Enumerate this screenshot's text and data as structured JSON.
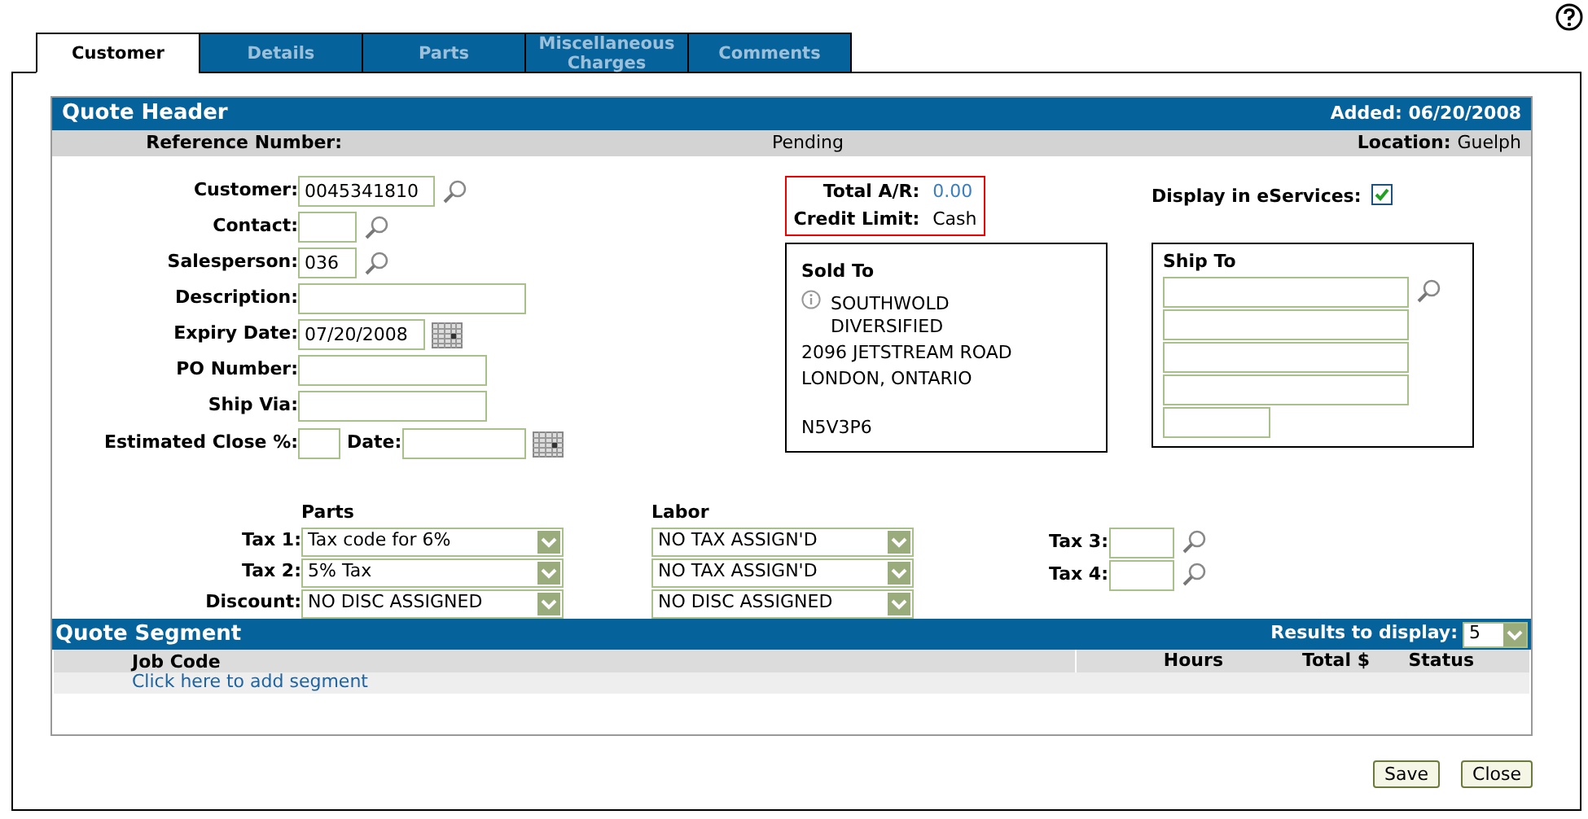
{
  "tabs": [
    {
      "label": "Customer",
      "selected": true
    },
    {
      "label": "Details",
      "selected": false
    },
    {
      "label": "Parts",
      "selected": false
    },
    {
      "label": "Miscellaneous Charges",
      "selected": false
    },
    {
      "label": "Comments",
      "selected": false
    }
  ],
  "quote_header": {
    "title": "Quote Header",
    "added": "Added: 06/20/2008",
    "reference_label": "Reference Number:",
    "reference_value": "Pending",
    "location_label": "Location:",
    "location_value": "Guelph"
  },
  "fields": [
    {
      "label": "Customer:",
      "value": "0045341810",
      "kind": "lookup"
    },
    {
      "label": "Contact:",
      "kind": "lookup"
    },
    {
      "label": "Salesperson:",
      "value": "036",
      "kind": "lookup"
    },
    {
      "label": "Description:",
      "kind": "text"
    },
    {
      "label": "Expiry Date:",
      "value": "07/20/2008",
      "kind": "date"
    },
    {
      "label": "PO Number:",
      "kind": "text"
    },
    {
      "label": "Ship Via:",
      "kind": "text"
    }
  ],
  "estimated_close": {
    "label": "Estimated Close %:",
    "date_label": "Date:"
  },
  "account": {
    "total_ar_label": "Total A/R:",
    "total_ar_value": "0.00",
    "credit_limit_label": "Credit Limit:",
    "credit_limit_value": "Cash"
  },
  "display_in_eservices": {
    "label": "Display in eServices:",
    "checked": true
  },
  "sold_to": {
    "title": "Sold To",
    "lines": [
      "SOUTHWOLD DIVERSIFIED",
      "2096 JETSTREAM ROAD",
      "LONDON, ONTARIO"
    ],
    "postal_code": "N5V3P6"
  },
  "ship_to": {
    "title": "Ship To"
  },
  "taxes": {
    "parts_label": "Parts",
    "labor_label": "Labor",
    "rows": [
      {
        "label": "Tax 1:",
        "parts": "Tax code for 6%",
        "labor": "NO TAX ASSIGN'D"
      },
      {
        "label": "Tax 2:",
        "parts": "5% Tax",
        "labor": "NO TAX ASSIGN'D"
      },
      {
        "label": "Discount:",
        "parts": "NO DISC ASSIGNED",
        "labor": "NO DISC ASSIGNED"
      }
    ]
  },
  "extra_taxes": [
    {
      "label": "Tax 3:"
    },
    {
      "label": "Tax 4:"
    }
  ],
  "quote_segment": {
    "title": "Quote Segment",
    "results_label": "Results to display:",
    "results_value": "5",
    "columns": [
      "Job Code",
      "Hours",
      "Total $",
      "Status"
    ],
    "add_link": "Click here to add segment"
  },
  "buttons": [
    "Save",
    "Close"
  ]
}
